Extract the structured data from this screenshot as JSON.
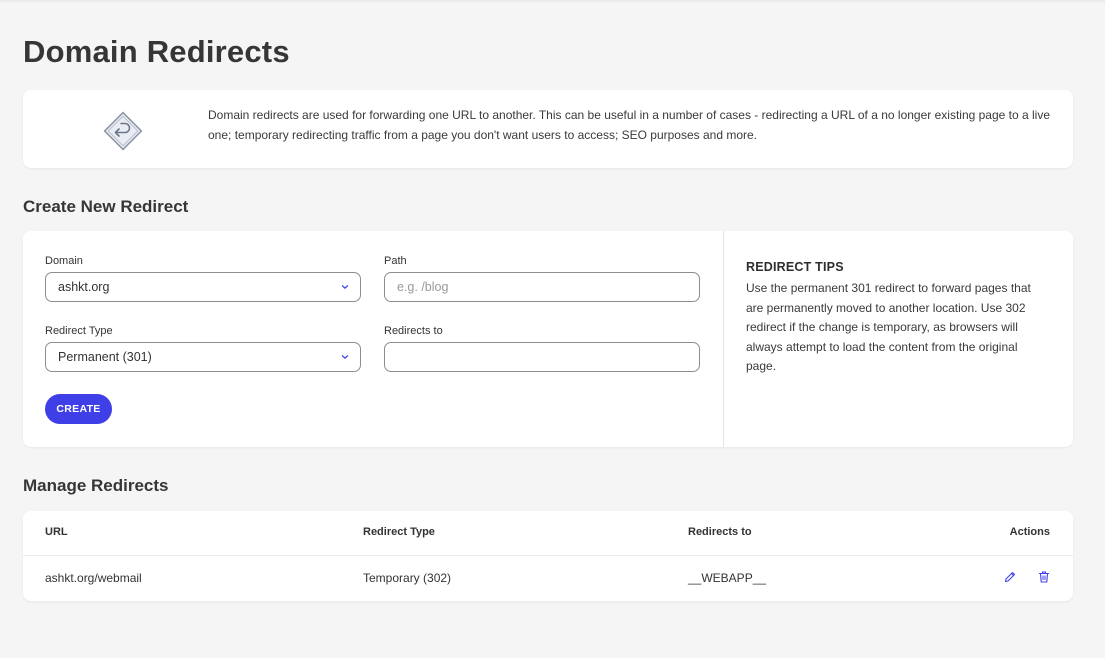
{
  "page": {
    "title": "Domain Redirects"
  },
  "info": {
    "icon": "redirect-sign-icon",
    "text": "Domain redirects are used for forwarding one URL to another. This can be useful in a number of cases - redirecting a URL of a no longer existing page to a live one; temporary redirecting traffic from a page you don't want users to access; SEO purposes and more."
  },
  "create": {
    "title": "Create New Redirect",
    "domain": {
      "label": "Domain",
      "value": "ashkt.org"
    },
    "path": {
      "label": "Path",
      "placeholder": "e.g. /blog",
      "value": ""
    },
    "redirect_type": {
      "label": "Redirect Type",
      "value": "Permanent (301)"
    },
    "redirects_to": {
      "label": "Redirects to",
      "value": ""
    },
    "button_label": "CREATE",
    "tips": {
      "title": "REDIRECT TIPS",
      "body": "Use the permanent 301 redirect to forward pages that are permanently moved to another location. Use 302 redirect if the change is temporary, as browsers will always attempt to load the content from the original page."
    }
  },
  "manage": {
    "title": "Manage Redirects",
    "columns": [
      "URL",
      "Redirect Type",
      "Redirects to",
      "Actions"
    ],
    "rows": [
      {
        "url": "ashkt.org/webmail",
        "type": "Temporary (302)",
        "target": "__WEBAPP__"
      }
    ]
  },
  "colors": {
    "accent": "#3f3fe8",
    "background": "#f5f5f5",
    "card": "#ffffff"
  }
}
